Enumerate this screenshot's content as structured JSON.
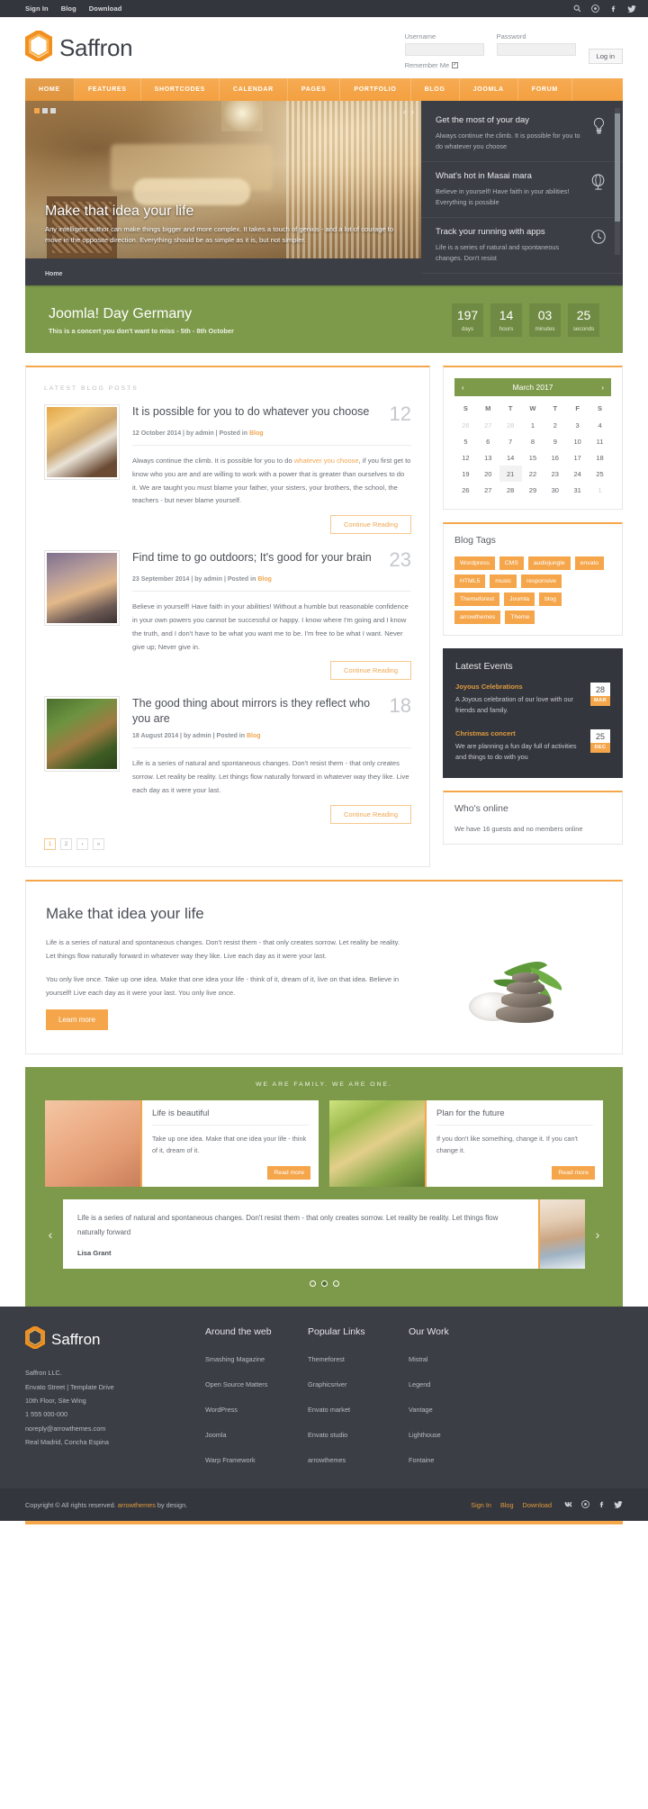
{
  "topbar": {
    "links": [
      {
        "label": "Sign In",
        "name": "sign-in"
      },
      {
        "label": "Blog",
        "name": "blog"
      },
      {
        "label": "Download",
        "name": "download"
      }
    ],
    "icons": [
      "search-icon",
      "dribbble-icon",
      "facebook-icon",
      "twitter-icon"
    ]
  },
  "header": {
    "brand": "Saffron",
    "login": {
      "username_label": "Username",
      "username_value": "",
      "password_label": "Password",
      "password_value": "",
      "remember_label": "Remember Me",
      "remember_checked": true,
      "submit_label": "Log in"
    }
  },
  "nav": {
    "items": [
      {
        "label": "HOME",
        "active": true
      },
      {
        "label": "FEATURES",
        "active": false
      },
      {
        "label": "SHORTCODES",
        "active": false
      },
      {
        "label": "CALENDAR",
        "active": false
      },
      {
        "label": "PAGES",
        "active": false
      },
      {
        "label": "PORTFOLIO",
        "active": false
      },
      {
        "label": "BLOG",
        "active": false
      },
      {
        "label": "JOOMLA",
        "active": false
      },
      {
        "label": "FORUM",
        "active": false
      }
    ]
  },
  "hero": {
    "slide_title": "Make that idea your life",
    "slide_desc": "Any intelligent author can make things bigger and more complex. It takes a touch of genius - and a lot of courage to move in the opposite direction. Everything should be as simple as it is, but not simpler.",
    "breadcrumb": "Home",
    "prev_arrow": "‹",
    "next_arrow": "›",
    "features": [
      {
        "title": "Get the most of your day",
        "desc": "Always continue the climb. It is possible for you to do whatever you choose",
        "icon": "lightbulb-icon"
      },
      {
        "title": "What's hot in Masai mara",
        "desc": "Believe in yourself! Have faith in your abilities! Everything is possible",
        "icon": "globe-icon"
      },
      {
        "title": "Track your running with apps",
        "desc": "Life is a series of natural and spontaneous changes. Don't resist",
        "icon": "clock-icon"
      }
    ]
  },
  "countdown": {
    "title": "Joomla! Day Germany",
    "subtitle": "This is a concert you don't want to miss - 5th - 8th October",
    "units": [
      {
        "value": "197",
        "label": "days"
      },
      {
        "value": "14",
        "label": "hours"
      },
      {
        "value": "03",
        "label": "minutes"
      },
      {
        "value": "25",
        "label": "seconds"
      }
    ]
  },
  "blog": {
    "section_label": "LATEST BLOG POSTS",
    "posts": [
      {
        "title": "It is possible for you to do whatever you choose",
        "day": "12",
        "meta_prefix": "12 October 2014 | by admin | Posted in ",
        "meta_link": "Blog",
        "excerpt_a": "Always continue the climb. It is possible for you to do ",
        "excerpt_link": "whatever you choose",
        "excerpt_b": ", if you first get to know who you are and are willing to work with a power that is greater than ourselves to do it. We are taught you must blame your father, your sisters, your brothers, the school, the teachers - but never blame yourself.",
        "cta": "Continue Reading"
      },
      {
        "title": "Find time to go outdoors; It's good for your brain",
        "day": "23",
        "meta_prefix": "23 September 2014 | by admin | Posted in ",
        "meta_link": "Blog",
        "excerpt_a": "Believe in yourself! Have faith in your abilities! Without a humble but reasonable confidence in your own powers you cannot be successful or happy. I know where I'm going and I know the truth, and I don't have to be what you want me to be. I'm free to be what I want. Never give up; Never give in.",
        "excerpt_link": "",
        "excerpt_b": "",
        "cta": "Continue Reading"
      },
      {
        "title": "The good thing about mirrors is they reflect who you are",
        "day": "18",
        "meta_prefix": "18 August 2014 | by admin | Posted in ",
        "meta_link": "Blog",
        "excerpt_a": "Life is a series of natural and spontaneous changes. Don't resist them - that only creates sorrow. Let reality be reality. Let things flow naturally forward in whatever way they like. Live each day as it were your last.",
        "excerpt_link": "",
        "excerpt_b": "",
        "cta": "Continue Reading"
      }
    ],
    "pager": [
      {
        "label": "1",
        "active": true
      },
      {
        "label": "2",
        "active": false
      },
      {
        "label": "›",
        "active": false
      },
      {
        "label": "»",
        "active": false
      }
    ]
  },
  "calendar": {
    "month_label": "March 2017",
    "prev": "‹",
    "next": "›",
    "weekdays": [
      "S",
      "M",
      "T",
      "W",
      "T",
      "F",
      "S"
    ],
    "weeks": [
      [
        {
          "d": "26",
          "mute": true
        },
        {
          "d": "27",
          "mute": true
        },
        {
          "d": "28",
          "mute": true
        },
        {
          "d": "1"
        },
        {
          "d": "2"
        },
        {
          "d": "3"
        },
        {
          "d": "4"
        }
      ],
      [
        {
          "d": "5"
        },
        {
          "d": "6"
        },
        {
          "d": "7"
        },
        {
          "d": "8"
        },
        {
          "d": "9"
        },
        {
          "d": "10"
        },
        {
          "d": "11"
        }
      ],
      [
        {
          "d": "12"
        },
        {
          "d": "13"
        },
        {
          "d": "14"
        },
        {
          "d": "15"
        },
        {
          "d": "16"
        },
        {
          "d": "17"
        },
        {
          "d": "18"
        }
      ],
      [
        {
          "d": "19"
        },
        {
          "d": "20"
        },
        {
          "d": "21",
          "today": true
        },
        {
          "d": "22"
        },
        {
          "d": "23"
        },
        {
          "d": "24"
        },
        {
          "d": "25"
        }
      ],
      [
        {
          "d": "26"
        },
        {
          "d": "27"
        },
        {
          "d": "28"
        },
        {
          "d": "29"
        },
        {
          "d": "30"
        },
        {
          "d": "31"
        },
        {
          "d": "1",
          "mute": true
        }
      ]
    ]
  },
  "tags_widget": {
    "title": "Blog Tags",
    "tags": [
      "Wordpress",
      "CMS",
      "audiojungle",
      "envato",
      "HTML5",
      "music",
      "responsive",
      "Themeforest",
      "Joomla",
      "blog",
      "arrowthemes",
      "Theme"
    ]
  },
  "events_widget": {
    "title": "Latest Events",
    "events": [
      {
        "title": "Joyous Celebrations",
        "desc": "A Joyous celebration of our love with our friends and family.",
        "day": "28",
        "month": "MAR"
      },
      {
        "title": "Christmas concert",
        "desc": "We are planning a fun day full of activities and things to do with you",
        "day": "25",
        "month": "DEC"
      }
    ]
  },
  "online_widget": {
    "title": "Who's online",
    "text": "We have 16 guests and no members online"
  },
  "promo": {
    "title": "Make that idea your life",
    "para1": "Life is a series of natural and spontaneous changes. Don't resist them - that only creates sorrow. Let reality be reality. Let things flow naturally forward in whatever way they like. Live each day as it were your last.",
    "para2": "You only live once. Take up one idea. Make that one idea your life - think of it, dream of it, live on that idea. Believe in yourself! Live each day as it were your last. You only live once.",
    "cta": "Learn more"
  },
  "family": {
    "label": "WE ARE FAMILY. WE ARE ONE.",
    "cards": [
      {
        "title": "Life is beautiful",
        "desc": "Take up one idea. Make that one idea your life - think of it, dream of it.",
        "cta": "Read more"
      },
      {
        "title": "Plan for the future",
        "desc": "If you don't like something, change it. If you can't change it.",
        "cta": "Read more"
      }
    ],
    "testimonial": {
      "quote": "Life is a series of natural and spontaneous changes. Don't resist them - that only creates sorrow. Let reality be reality. Let things flow naturally forward",
      "author": "Lisa Grant",
      "prev": "‹",
      "next": "›",
      "dots": [
        false,
        true,
        false
      ]
    }
  },
  "footer": {
    "brand": "Saffron",
    "address": [
      "Saffron LLC.",
      "Envato Street | Template Drive",
      "10th Floor, Site Wing",
      "1 555 000-000",
      "noreply@arrowthemes.com",
      "Real Madrid, Concha Espina"
    ],
    "columns": [
      {
        "title": "Around the web",
        "links": [
          "Smashing Magazine",
          "Open Source Matters",
          "WordPress",
          "Joomla",
          "Warp Framework"
        ]
      },
      {
        "title": "Popular Links",
        "links": [
          "Themeforest",
          "Graphicsriver",
          "Envato market",
          "Envato studio",
          "arrowthemes"
        ]
      },
      {
        "title": "Our Work",
        "links": [
          "Mistral",
          "Legend",
          "Vantage",
          "Lighthouse",
          "Fontaine"
        ]
      }
    ]
  },
  "copyright": {
    "text_before": "Copyright © All rights reserved. ",
    "link": "arrowthemes",
    "text_after": " by design.",
    "links": [
      "Sign In",
      "Blog",
      "Download"
    ],
    "icons": [
      "vk-icon",
      "dribbble-icon",
      "facebook-icon",
      "twitter-icon"
    ]
  },
  "colors": {
    "accent": "#f5a64b",
    "green": "#7d9a4b",
    "dark": "#3b3e45",
    "darker": "#33363c"
  }
}
